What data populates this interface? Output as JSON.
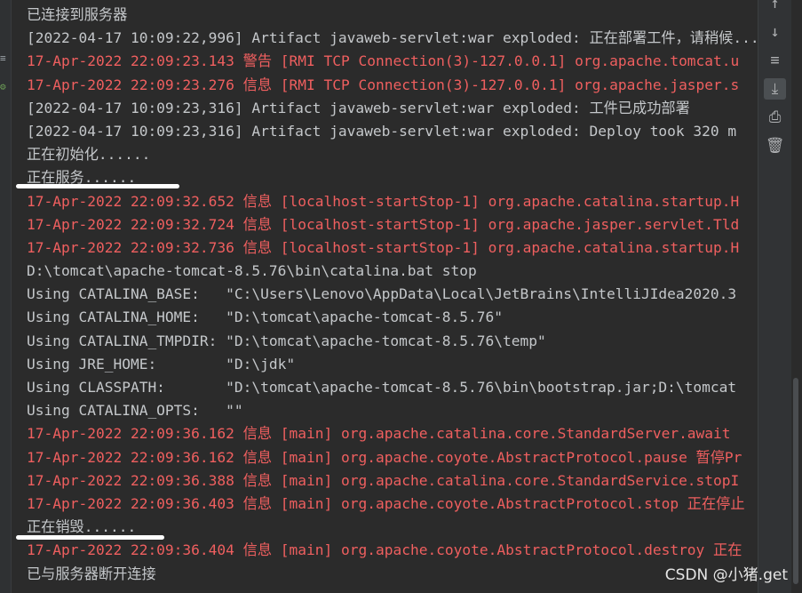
{
  "console": {
    "lines": [
      {
        "type": "sys",
        "text": "已连接到服务器"
      },
      {
        "type": "sys",
        "text": "[2022-04-17 10:09:22,996] Artifact javaweb-servlet:war exploded: 正在部署工件，请稍候..."
      },
      {
        "type": "err",
        "text": "17-Apr-2022 22:09:23.143 警告 [RMI TCP Connection(3)-127.0.0.1] org.apache.tomcat.u"
      },
      {
        "type": "err",
        "text": "17-Apr-2022 22:09:23.276 信息 [RMI TCP Connection(3)-127.0.0.1] org.apache.jasper.s"
      },
      {
        "type": "sys",
        "text": "[2022-04-17 10:09:23,316] Artifact javaweb-servlet:war exploded: 工件已成功部署"
      },
      {
        "type": "sys",
        "text": "[2022-04-17 10:09:23,316] Artifact javaweb-servlet:war exploded: Deploy took 320 m"
      },
      {
        "type": "sys",
        "text": "正在初始化......"
      },
      {
        "type": "sys",
        "text": "正在服务......"
      },
      {
        "type": "err",
        "text": "17-Apr-2022 22:09:32.652 信息 [localhost-startStop-1] org.apache.catalina.startup.H"
      },
      {
        "type": "err",
        "text": "17-Apr-2022 22:09:32.724 信息 [localhost-startStop-1] org.apache.jasper.servlet.Tld"
      },
      {
        "type": "err",
        "text": "17-Apr-2022 22:09:32.736 信息 [localhost-startStop-1] org.apache.catalina.startup.H"
      },
      {
        "type": "sys",
        "text": "D:\\tomcat\\apache-tomcat-8.5.76\\bin\\catalina.bat stop"
      },
      {
        "type": "sys",
        "text": "Using CATALINA_BASE:   \"C:\\Users\\Lenovo\\AppData\\Local\\JetBrains\\IntelliJIdea2020.3"
      },
      {
        "type": "sys",
        "text": "Using CATALINA_HOME:   \"D:\\tomcat\\apache-tomcat-8.5.76\""
      },
      {
        "type": "sys",
        "text": "Using CATALINA_TMPDIR: \"D:\\tomcat\\apache-tomcat-8.5.76\\temp\""
      },
      {
        "type": "sys",
        "text": "Using JRE_HOME:        \"D:\\jdk\""
      },
      {
        "type": "sys",
        "text": "Using CLASSPATH:       \"D:\\tomcat\\apache-tomcat-8.5.76\\bin\\bootstrap.jar;D:\\tomcat"
      },
      {
        "type": "sys",
        "text": "Using CATALINA_OPTS:   \"\""
      },
      {
        "type": "err",
        "text": "17-Apr-2022 22:09:36.162 信息 [main] org.apache.catalina.core.StandardServer.await"
      },
      {
        "type": "err",
        "text": "17-Apr-2022 22:09:36.162 信息 [main] org.apache.coyote.AbstractProtocol.pause 暂停Pr"
      },
      {
        "type": "err",
        "text": "17-Apr-2022 22:09:36.388 信息 [main] org.apache.catalina.core.StandardService.stopI"
      },
      {
        "type": "err",
        "text": "17-Apr-2022 22:09:36.403 信息 [main] org.apache.coyote.AbstractProtocol.stop 正在停止"
      },
      {
        "type": "sys",
        "text": "正在销毁......"
      },
      {
        "type": "err",
        "text": "17-Apr-2022 22:09:36.404 信息 [main] org.apache.coyote.AbstractProtocol.destroy 正在"
      },
      {
        "type": "sys",
        "text": "已与服务器断开连接"
      }
    ]
  },
  "toolbar": {
    "tools": [
      {
        "name": "scroll-up-icon",
        "glyph": "↑"
      },
      {
        "name": "scroll-down-icon",
        "glyph": "↓"
      },
      {
        "name": "soft-wrap-icon",
        "glyph": "≡"
      },
      {
        "name": "scroll-to-end-icon",
        "glyph": "⤓"
      },
      {
        "name": "print-icon",
        "glyph": "⎙"
      },
      {
        "name": "clear-all-icon",
        "glyph": "🗑"
      }
    ]
  },
  "gutter": {
    "marks": [
      "≡",
      "⚙"
    ]
  },
  "watermark": "CSDN @小猪.get",
  "colors": {
    "background": "#2b2b2b",
    "system_text": "#c4c7ca",
    "error_text": "#ef5f5f"
  }
}
